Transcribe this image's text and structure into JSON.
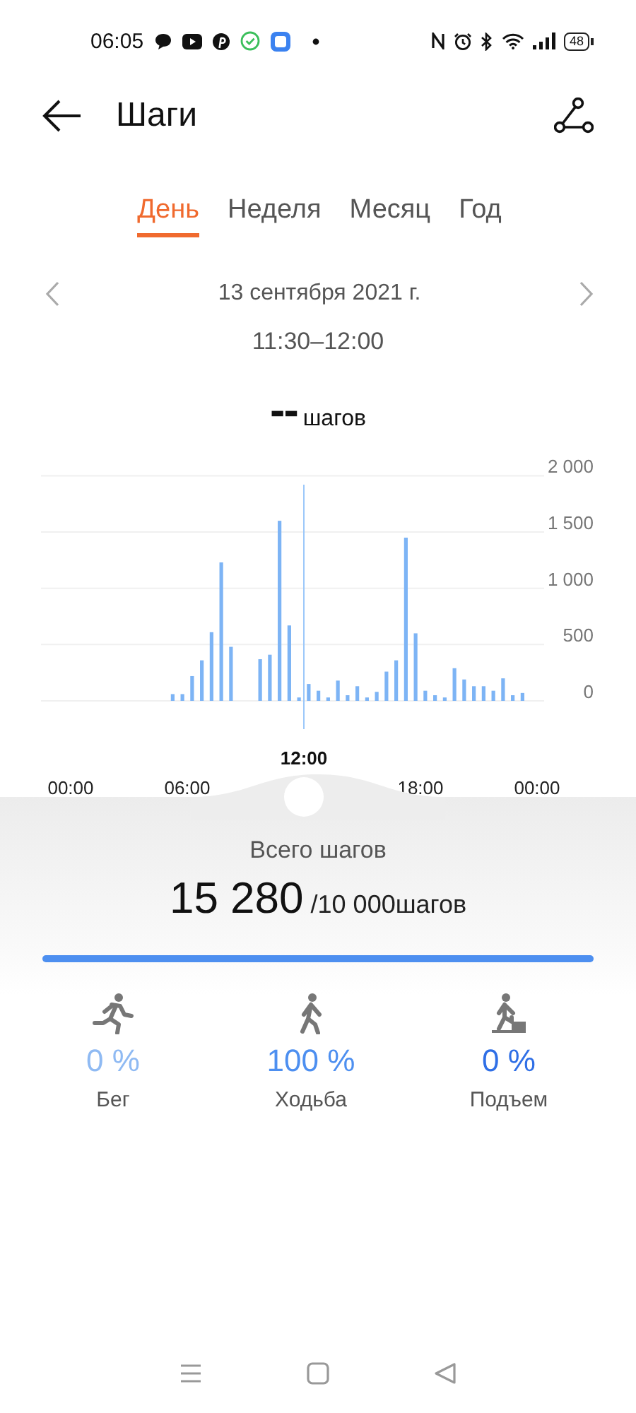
{
  "status_bar": {
    "time": "06:05",
    "battery": "48"
  },
  "header": {
    "title": "Шаги"
  },
  "tabs": [
    {
      "label": "День",
      "selected": true
    },
    {
      "label": "Неделя",
      "selected": false
    },
    {
      "label": "Месяц",
      "selected": false
    },
    {
      "label": "Год",
      "selected": false
    }
  ],
  "date": "13 сентября 2021 г.",
  "time_range": "11:30–12:00",
  "reading": {
    "value": "--",
    "unit": "шагов"
  },
  "chart_data": {
    "type": "bar",
    "x": [
      0,
      0.5,
      1,
      1.5,
      2,
      2.5,
      3,
      3.5,
      4,
      4.5,
      5,
      5.5,
      6,
      6.5,
      7,
      7.5,
      8,
      8.5,
      9,
      9.5,
      10,
      10.5,
      11,
      11.5,
      12,
      12.5,
      13,
      13.5,
      14,
      14.5,
      15,
      15.5,
      16,
      16.5,
      17,
      17.5,
      18,
      18.5,
      19,
      19.5,
      20,
      20.5,
      21,
      21.5,
      22,
      22.5,
      23,
      23.5
    ],
    "values": [
      0,
      0,
      0,
      0,
      0,
      0,
      0,
      0,
      0,
      0,
      60,
      60,
      220,
      360,
      610,
      1230,
      480,
      0,
      0,
      370,
      410,
      1600,
      670,
      30,
      150,
      90,
      30,
      180,
      50,
      130,
      30,
      80,
      260,
      360,
      1450,
      600,
      90,
      50,
      30,
      290,
      190,
      130,
      130,
      90,
      200,
      50,
      70,
      0
    ],
    "xlim": [
      0,
      24
    ],
    "ylim": [
      0,
      2000
    ],
    "grid": true,
    "yticks": [
      {
        "value": 0,
        "label": "0"
      },
      {
        "value": 500,
        "label": "500"
      },
      {
        "value": 1000,
        "label": "1 000"
      },
      {
        "value": 1500,
        "label": "1 500"
      },
      {
        "value": 2000,
        "label": "2 000"
      }
    ],
    "xticks": [
      {
        "value": 0,
        "label": "00:00"
      },
      {
        "value": 6,
        "label": "06:00"
      },
      {
        "value": 18,
        "label": "18:00"
      },
      {
        "value": 24,
        "label": "00:00"
      }
    ],
    "ref_lines": [
      {
        "axis": "x",
        "value": 12,
        "label": "12:00",
        "color": "#9cc8fa"
      }
    ]
  },
  "summary": {
    "title": "Всего шагов",
    "total": "15 280",
    "goal": "/10 000шагов",
    "level": 1
  },
  "activities": [
    {
      "kind": "run",
      "percent": "0 %",
      "label": "Бег",
      "color": "#8fbaf3"
    },
    {
      "kind": "walk",
      "percent": "100 %",
      "label": "Ходьба",
      "color": "#4d8ff0"
    },
    {
      "kind": "climb",
      "percent": "0 %",
      "label": "Подъем",
      "color": "#2f6fe6"
    }
  ]
}
